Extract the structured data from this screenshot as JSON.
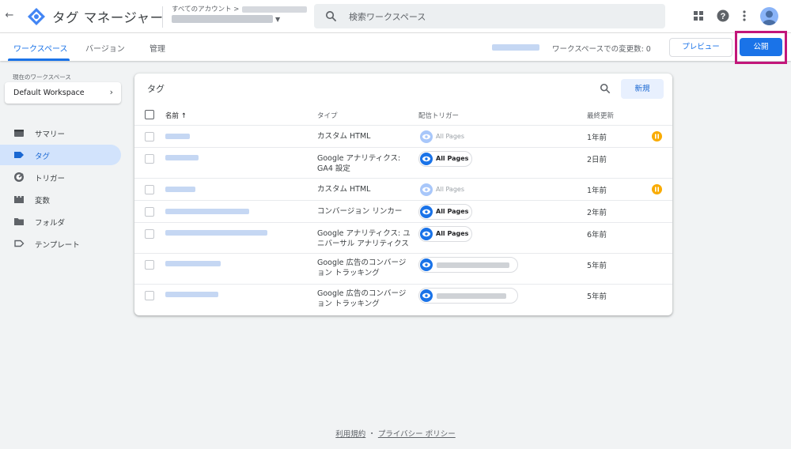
{
  "header": {
    "product_name": "タグ マネージャー",
    "account_crumb": "すべてのアカウント >",
    "search_placeholder": "検索ワークスペース"
  },
  "tabs": [
    {
      "label": "ワークスペース",
      "active": true
    },
    {
      "label": "バージョン",
      "active": false
    },
    {
      "label": "管理",
      "active": false
    }
  ],
  "workspace_bar": {
    "changes_text": "ワークスペースでの変更数: 0",
    "preview_label": "プレビュー",
    "publish_label": "公開"
  },
  "sidebar": {
    "current_workspace_label": "現在のワークスペース",
    "workspace_name": "Default Workspace",
    "items": [
      {
        "label": "サマリー",
        "icon": "summary-icon",
        "active": false
      },
      {
        "label": "タグ",
        "icon": "tag-icon",
        "active": true
      },
      {
        "label": "トリガー",
        "icon": "trigger-icon",
        "active": false
      },
      {
        "label": "変数",
        "icon": "variables-icon",
        "active": false
      },
      {
        "label": "フォルダ",
        "icon": "folder-icon",
        "active": false
      },
      {
        "label": "テンプレート",
        "icon": "template-icon",
        "active": false
      }
    ]
  },
  "tags_card": {
    "title": "タグ",
    "new_label": "新規",
    "columns": {
      "name": "名前",
      "type": "タイプ",
      "trigger": "配信トリガー",
      "updated": "最終更新"
    },
    "rows": [
      {
        "type": "カスタム HTML",
        "trigger": "All Pages",
        "trigger_paused": true,
        "updated": "1年前",
        "paused": true
      },
      {
        "type": "Google アナリティクス: GA4 設定",
        "trigger": "All Pages",
        "trigger_paused": false,
        "updated": "2日前",
        "paused": false
      },
      {
        "type": "カスタム HTML",
        "trigger": "All Pages",
        "trigger_paused": true,
        "updated": "1年前",
        "paused": true
      },
      {
        "type": "コンバージョン リンカー",
        "trigger": "All Pages",
        "trigger_paused": false,
        "updated": "2年前",
        "paused": false
      },
      {
        "type": "Google アナリティクス: ユニバーサル アナリティクス",
        "trigger": "All Pages",
        "trigger_paused": false,
        "updated": "6年前",
        "paused": false
      },
      {
        "type": "Google 広告のコンバージョン トラッキング",
        "trigger": "",
        "trigger_paused": false,
        "updated": "5年前",
        "paused": false
      },
      {
        "type": "Google 広告のコンバージョン トラッキング",
        "trigger": "",
        "trigger_paused": false,
        "updated": "5年前",
        "paused": false
      }
    ]
  },
  "footer": {
    "terms": "利用規約",
    "separator": "・",
    "privacy": "プライバシー ポリシー"
  },
  "colors": {
    "accent": "#1a73e8",
    "highlight_frame": "#c2167a",
    "paused_badge": "#f9ab00"
  }
}
